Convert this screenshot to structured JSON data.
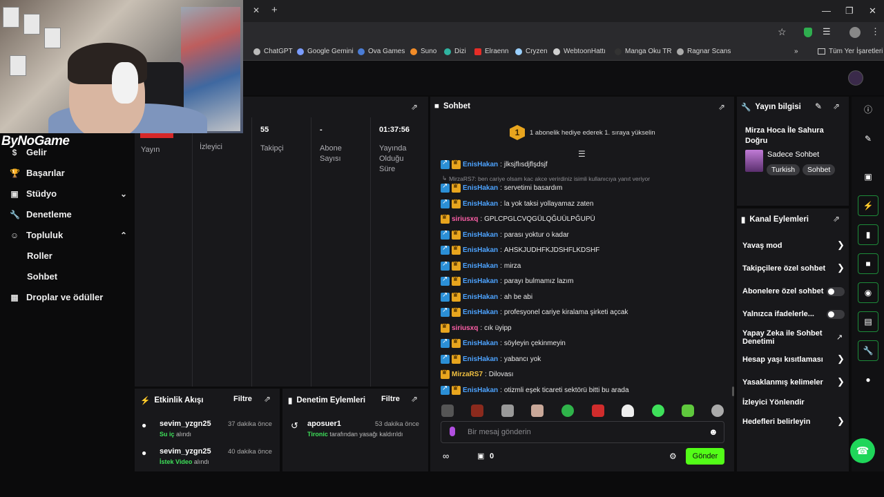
{
  "browser": {
    "bookmarks": [
      {
        "label": "ChatGPT",
        "icon": "chatgpt-icon"
      },
      {
        "label": "Google Gemini",
        "icon": "gemini-icon"
      },
      {
        "label": "Ova Games",
        "icon": "ova-icon"
      },
      {
        "label": "Suno",
        "icon": "suno-icon"
      },
      {
        "label": "Dizi",
        "icon": "dizi-icon"
      },
      {
        "label": "Elraenn",
        "icon": "youtube-icon"
      },
      {
        "label": "Cryzen",
        "icon": "cryzen-icon"
      },
      {
        "label": "WebtoonHattı",
        "icon": "webtoon-icon"
      },
      {
        "label": "Manga Oku TR",
        "icon": "manga-icon"
      },
      {
        "label": "Ragnar Scans",
        "icon": "ragnar-icon"
      }
    ],
    "all_bookmarks": "Tüm Yer İşaretleri",
    "tab_close": "✕",
    "tab_new": "+"
  },
  "overlay": {
    "logo": "ByNoGame"
  },
  "sidebar": {
    "items": [
      {
        "label": "Gelir"
      },
      {
        "label": "Başarılar"
      },
      {
        "label": "Stüdyo"
      },
      {
        "label": "Denetleme"
      },
      {
        "label": "Topluluk"
      },
      {
        "label": "Roller"
      },
      {
        "label": "Sohbet"
      },
      {
        "label": "Droplar ve ödüller"
      }
    ]
  },
  "stats": [
    {
      "value": "",
      "label": "Yayın"
    },
    {
      "value": "",
      "label": "İzleyici"
    },
    {
      "value": "55",
      "label": "Takipçi"
    },
    {
      "value": "-",
      "label": "Abone Sayısı"
    },
    {
      "value": "01:37:56",
      "label": "Yayında Olduğu Süre"
    }
  ],
  "chat": {
    "title": "Sohbet",
    "gift_banner": "1 abonelik hediye ederek 1. sıraya yükselin",
    "gift_rank": "1",
    "reply_note": "MirzaRS7: ben cariye olsam kac akce verirdiniz isimli kullanıcıya yanıt veriyor",
    "messages": [
      {
        "user": "EnisHakan",
        "color": "#4da3ff",
        "text": "jlksjflısdjflşdsjf",
        "badges": 2
      },
      {
        "user": "EnisHakan",
        "color": "#4da3ff",
        "text": "servetimi basardım",
        "badges": 2
      },
      {
        "user": "EnisHakan",
        "color": "#4da3ff",
        "text": "la yok taksi yollayamaz zaten",
        "badges": 2
      },
      {
        "user": "siriusxq",
        "color": "#ff5fa8",
        "text": "GPLCPGLCVQGÜLQĞUÜLPĞUPÜ",
        "badges": 1
      },
      {
        "user": "EnisHakan",
        "color": "#4da3ff",
        "text": "parası yoktur o kadar",
        "badges": 2
      },
      {
        "user": "EnisHakan",
        "color": "#4da3ff",
        "text": "AHSKJUDHFKJDSHFLKDSHF",
        "badges": 2
      },
      {
        "user": "EnisHakan",
        "color": "#4da3ff",
        "text": "mirza",
        "badges": 2
      },
      {
        "user": "EnisHakan",
        "color": "#4da3ff",
        "text": "parayı bulmamız lazım",
        "badges": 2
      },
      {
        "user": "EnisHakan",
        "color": "#4da3ff",
        "text": "ah be abi",
        "badges": 2
      },
      {
        "user": "EnisHakan",
        "color": "#4da3ff",
        "text": "profesyonel cariye kiralama şirketi açcak",
        "badges": 2
      },
      {
        "user": "siriusxq",
        "color": "#ff5fa8",
        "text": "cık üyipp",
        "badges": 1
      },
      {
        "user": "EnisHakan",
        "color": "#4da3ff",
        "text": "söyleyin çekinmeyin",
        "badges": 2
      },
      {
        "user": "EnisHakan",
        "color": "#4da3ff",
        "text": "yabancı yok",
        "badges": 2
      },
      {
        "user": "MirzaRS7",
        "color": "#f0c040",
        "text": "Dilovası",
        "badges": 1
      },
      {
        "user": "EnisHakan",
        "color": "#4da3ff",
        "text": "otizmli eşek ticareti sektörü bitti bu arada",
        "badges": 2
      }
    ],
    "input_placeholder": "Bir mesaj gönderin",
    "points": "0",
    "send_label": "Gönder"
  },
  "stream_info": {
    "title": "Yayın bilgisi",
    "stream_title": "Mirza Hoca İle Sahura Doğru",
    "category": "Sadece Sohbet",
    "tags": [
      "Turkish",
      "Sohbet"
    ]
  },
  "channel_actions": {
    "title": "Kanal Eylemleri",
    "items": [
      {
        "label": "Yavaş mod",
        "kind": "chevron"
      },
      {
        "label": "Takipçilere özel sohbet",
        "kind": "chevron"
      },
      {
        "label": "Abonelere özel sohbet",
        "kind": "toggle"
      },
      {
        "label": "Yalnızca ifadelerle...",
        "kind": "toggle"
      },
      {
        "label": "Yapay Zeka ile Sohbet Denetimi",
        "kind": "external"
      },
      {
        "label": "Hesap yaşı kısıtlaması",
        "kind": "chevron"
      },
      {
        "label": "Yasaklanmış kelimeler",
        "kind": "chevron"
      },
      {
        "label": "İzleyici Yönlendir",
        "kind": "none"
      },
      {
        "label": "Hedefleri belirleyin",
        "kind": "chevron"
      }
    ]
  },
  "activity": {
    "title": "Etkinlik Akışı",
    "filter": "Filtre",
    "items": [
      {
        "name": "sevim_yzgn25",
        "time": "37 dakika önce",
        "highlight": "Su iç",
        "rest": " alındı"
      },
      {
        "name": "sevim_yzgn25",
        "time": "40 dakika önce",
        "highlight": "İstek Video",
        "rest": " alındı"
      }
    ]
  },
  "moderation": {
    "title": "Denetim Eylemleri",
    "filter": "Filtre",
    "items": [
      {
        "name": "aposuer1",
        "time": "53 dakika önce",
        "highlight": "Tironic",
        "rest": " tarafından yasağı kaldırıldı"
      }
    ]
  },
  "colors": {
    "accent": "#53fc18",
    "panel": "#18181b",
    "bg": "#0b0b0c"
  }
}
